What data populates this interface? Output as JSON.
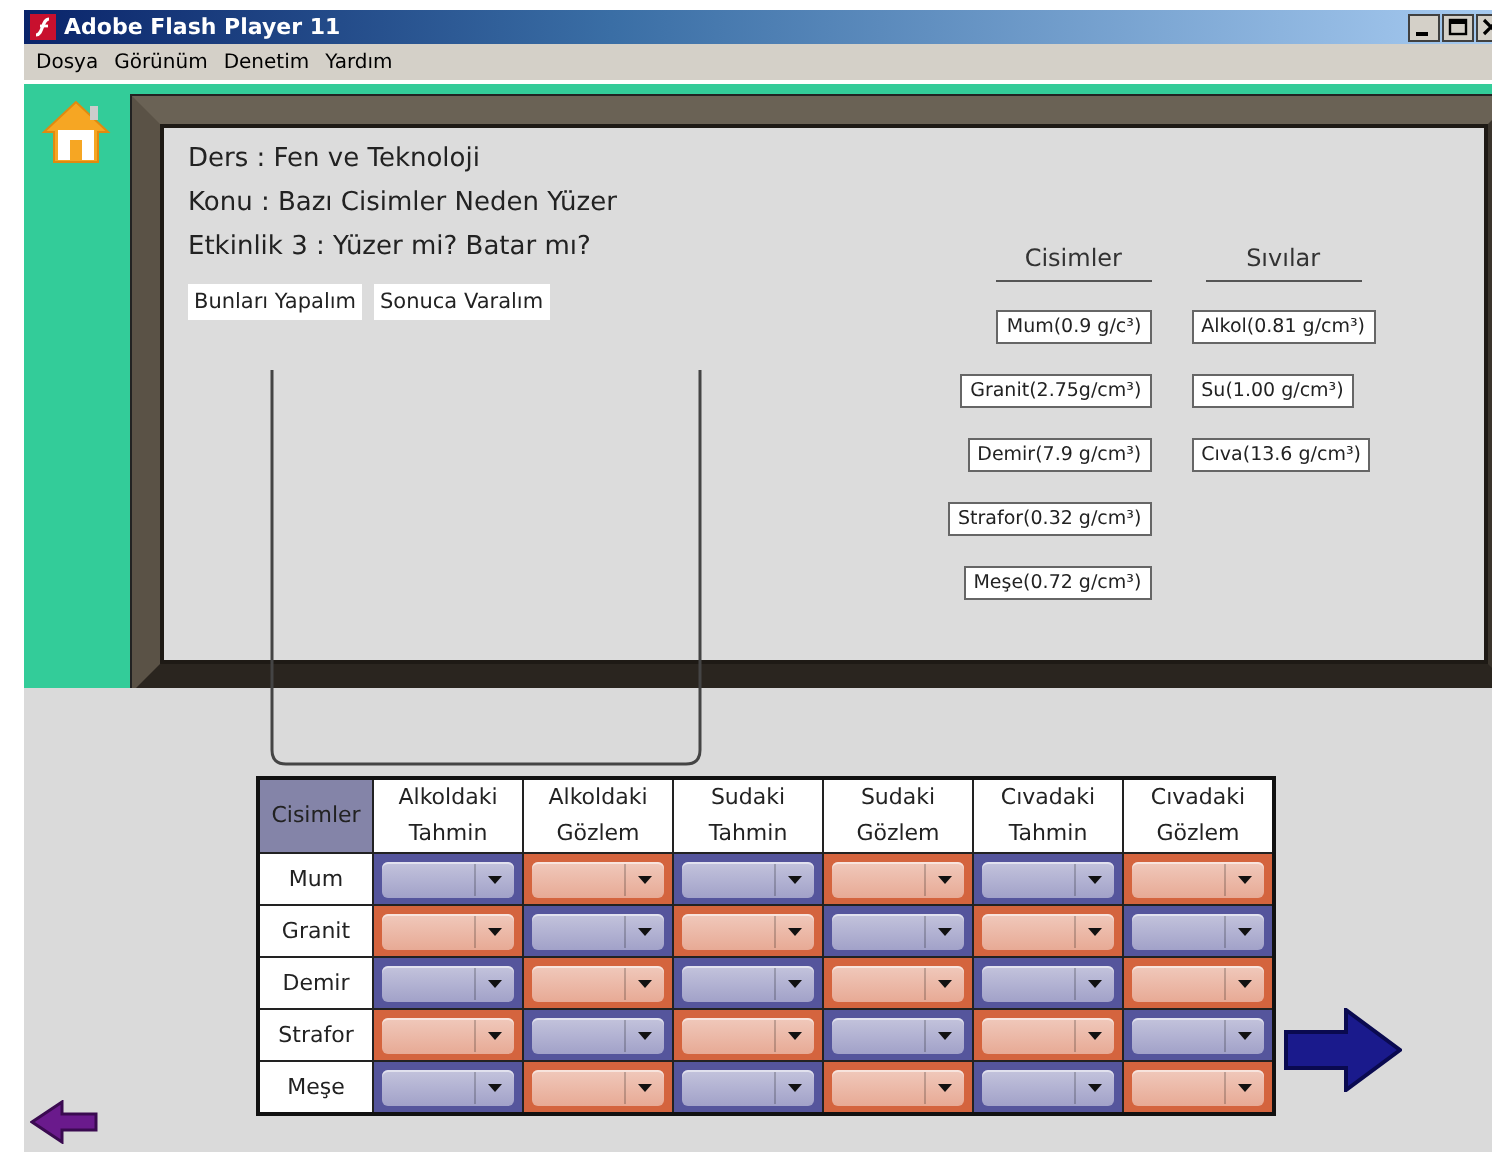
{
  "window": {
    "title": "Adobe Flash Player 11"
  },
  "menu": [
    "Dosya",
    "Görünüm",
    "Denetim",
    "Yardım"
  ],
  "lesson": {
    "lines": [
      "Ders : Fen ve Teknoloji",
      "Konu : Bazı Cisimler Neden Yüzer",
      "Etkinlik 3 : Yüzer mi? Batar mı?"
    ],
    "buttons": [
      "Bunları Yapalım",
      "Sonuca Varalım"
    ]
  },
  "objects": {
    "heading": "Cisimler",
    "items": [
      "Mum(0.9 g/c³)",
      "Granit(2.75g/cm³)",
      "Demir(7.9 g/cm³)",
      "Strafor(0.32 g/cm³)",
      "Meşe(0.72 g/cm³)"
    ]
  },
  "liquids": {
    "heading": "Sıvılar",
    "items": [
      "Alkol(0.81 g/cm³)",
      "Su(1.00 g/cm³)",
      "Cıva(13.6  g/cm³)"
    ]
  },
  "table": {
    "columns": [
      "Cisimler",
      "Alkoldaki Tahmin",
      "Alkoldaki Gözlem",
      "Sudaki Tahmin",
      "Sudaki Gözlem",
      "Cıvadaki Tahmin",
      "Cıvadaki Gözlem"
    ],
    "rows": [
      {
        "label": "Mum",
        "cells": [
          {
            "color": "#55559c"
          },
          {
            "color": "#d4643e"
          },
          {
            "color": "#55559c"
          },
          {
            "color": "#d4643e"
          },
          {
            "color": "#55559c"
          },
          {
            "color": "#d4643e"
          }
        ]
      },
      {
        "label": "Granit",
        "cells": [
          {
            "color": "#d4643e"
          },
          {
            "color": "#55559c"
          },
          {
            "color": "#d4643e"
          },
          {
            "color": "#55559c"
          },
          {
            "color": "#d4643e"
          },
          {
            "color": "#55559c"
          }
        ]
      },
      {
        "label": "Demir",
        "cells": [
          {
            "color": "#55559c"
          },
          {
            "color": "#d4643e"
          },
          {
            "color": "#55559c"
          },
          {
            "color": "#d4643e"
          },
          {
            "color": "#55559c"
          },
          {
            "color": "#d4643e"
          }
        ]
      },
      {
        "label": "Strafor",
        "cells": [
          {
            "color": "#d4643e"
          },
          {
            "color": "#55559c"
          },
          {
            "color": "#d4643e"
          },
          {
            "color": "#55559c"
          },
          {
            "color": "#d4643e"
          },
          {
            "color": "#55559c"
          }
        ]
      },
      {
        "label": "Meşe",
        "cells": [
          {
            "color": "#55559c"
          },
          {
            "color": "#d4643e"
          },
          {
            "color": "#55559c"
          },
          {
            "color": "#d4643e"
          },
          {
            "color": "#55559c"
          },
          {
            "color": "#d4643e"
          }
        ]
      }
    ]
  }
}
